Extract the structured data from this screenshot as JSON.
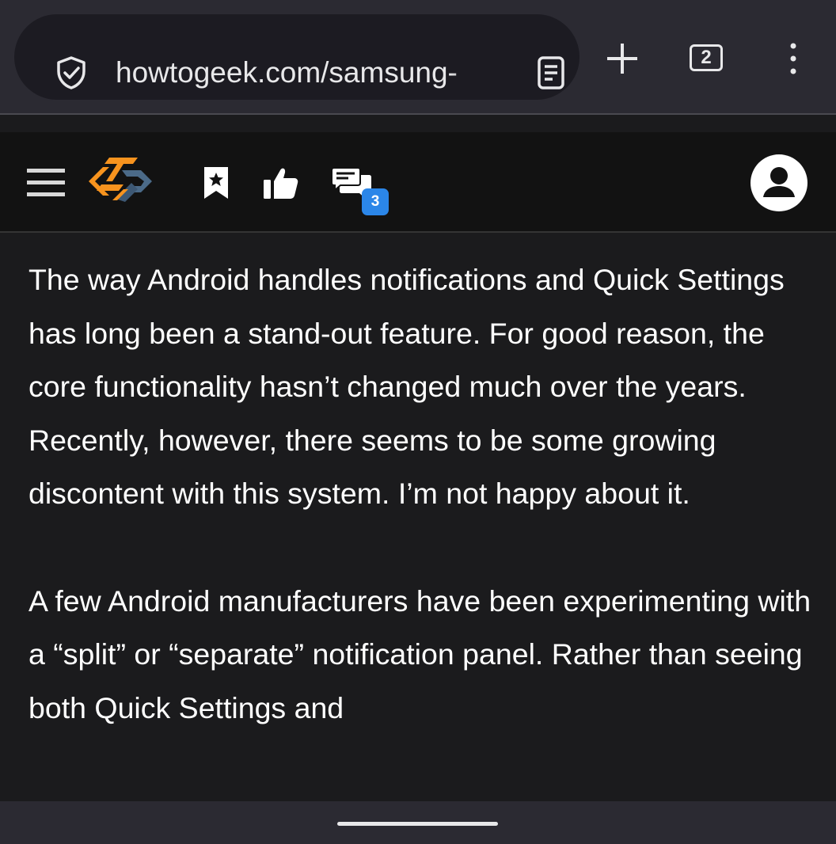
{
  "browser": {
    "url": "howtogeek.com/samsung-",
    "tab_count": "2",
    "icons": {
      "security": "shield-check-icon",
      "reader": "reader-mode-icon",
      "new_tab": "plus-icon",
      "menu": "more-vert-icon"
    }
  },
  "site_header": {
    "logo_name": "HTG",
    "comment_count": "3",
    "icons": [
      "hamburger-menu-icon",
      "bookmark-star-icon",
      "thumbs-up-icon",
      "comments-icon",
      "account-icon"
    ],
    "colors": {
      "logo_orange": "#f7931e",
      "logo_blue": "#4b6a88",
      "badge": "#2b86e8"
    }
  },
  "article": {
    "paragraphs": [
      "The way Android handles notifications and Quick Settings has long been a stand-out feature. For good reason, the core functionality hasn’t changed much over the years. Recently, however, there seems to be some growing discontent with this system. I’m not happy about it.",
      "A few Android manufacturers have been experimenting with a “split” or “separate” notification panel. Rather than seeing both Quick Settings and"
    ]
  }
}
